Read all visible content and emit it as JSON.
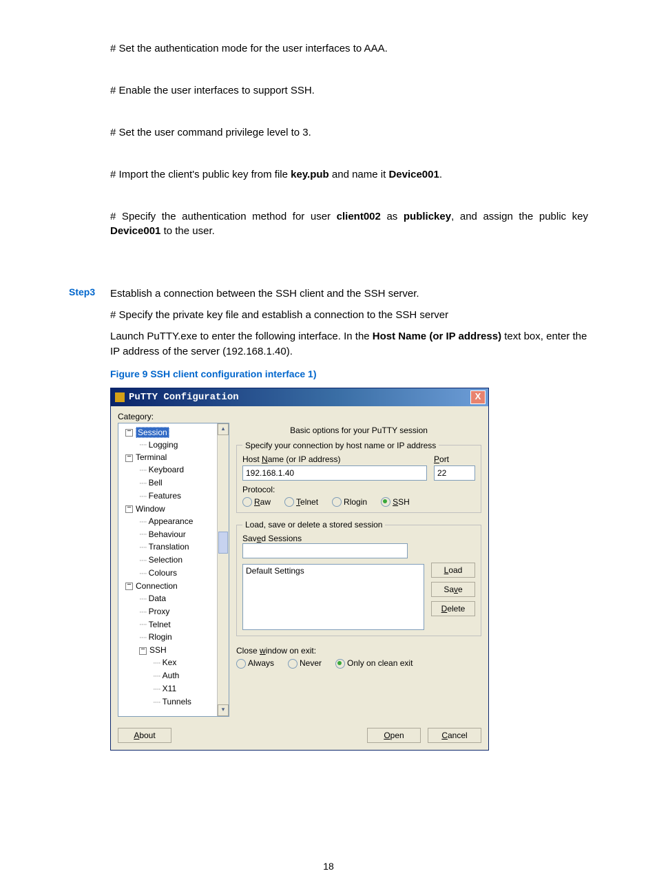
{
  "doc": {
    "line1": "# Set the authentication mode for the user interfaces to AAA.",
    "line2": "# Enable the user interfaces to support SSH.",
    "line3": "# Set the user command privilege level to 3.",
    "line4_a": "# Import the client's public key from file ",
    "line4_b": "key.pub",
    "line4_c": " and name it ",
    "line4_d": "Device001",
    "line4_e": ".",
    "line5_a": "# Specify the authentication method for user ",
    "line5_b": "client002",
    "line5_c": " as ",
    "line5_d": "publickey",
    "line5_e": ", and assign the public key ",
    "line5_f": "Device001",
    "line5_g": " to the user.",
    "step3_label": "Step3",
    "step3_text": "Establish a connection between the SSH client and the SSH server.",
    "after1": "# Specify the private key file and establish a connection to the SSH server",
    "after2_a": "Launch PuTTY.exe to enter the following interface. In the ",
    "after2_b": "Host Name (or IP address)",
    "after2_c": " text box, enter the IP address of the server (192.168.1.40).",
    "figure_caption": "Figure 9 SSH client configuration interface 1)",
    "page_number": "18"
  },
  "putty": {
    "title": "PuTTY Configuration",
    "close_x": "X",
    "category_label": "Category:",
    "tree": {
      "session": "Session",
      "logging": "Logging",
      "terminal": "Terminal",
      "keyboard": "Keyboard",
      "bell": "Bell",
      "features": "Features",
      "window": "Window",
      "appearance": "Appearance",
      "behaviour": "Behaviour",
      "translation": "Translation",
      "selection": "Selection",
      "colours": "Colours",
      "connection": "Connection",
      "data": "Data",
      "proxy": "Proxy",
      "telnet": "Telnet",
      "rlogin": "Rlogin",
      "ssh": "SSH",
      "kex": "Kex",
      "auth": "Auth",
      "x11": "X11",
      "tunnels": "Tunnels"
    },
    "panel": {
      "title": "Basic options for your PuTTY session",
      "group1_legend": "Specify your connection by host name or IP address",
      "host_label_pre": "Host ",
      "host_label_u": "N",
      "host_label_post": "ame (or IP address)",
      "host_value": "192.168.1.40",
      "port_label_u": "P",
      "port_label_post": "ort",
      "port_value": "22",
      "protocol_label": "Protocol:",
      "proto_raw_u": "R",
      "proto_raw_post": "aw",
      "proto_telnet_u": "T",
      "proto_telnet_post": "elnet",
      "proto_rlogin": "Rlogin",
      "proto_ssh_u": "S",
      "proto_ssh_post": "SH",
      "group2_legend": "Load, save or delete a stored session",
      "saved_label_pre": "Sav",
      "saved_label_u": "e",
      "saved_label_post": "d Sessions",
      "saved_value": "",
      "default_settings": "Default Settings",
      "btn_load_u": "L",
      "btn_load_post": "oad",
      "btn_save_pre": "Sa",
      "btn_save_u": "v",
      "btn_save_post": "e",
      "btn_delete_u": "D",
      "btn_delete_post": "elete",
      "close_label_pre": "Close ",
      "close_label_u": "w",
      "close_label_post": "indow on exit:",
      "close_always": "Always",
      "close_never": "Never",
      "close_clean": "Only on clean exit"
    },
    "footer": {
      "about_u": "A",
      "about_post": "bout",
      "open_u": "O",
      "open_post": "pen",
      "cancel_u": "C",
      "cancel_post": "ancel"
    }
  }
}
